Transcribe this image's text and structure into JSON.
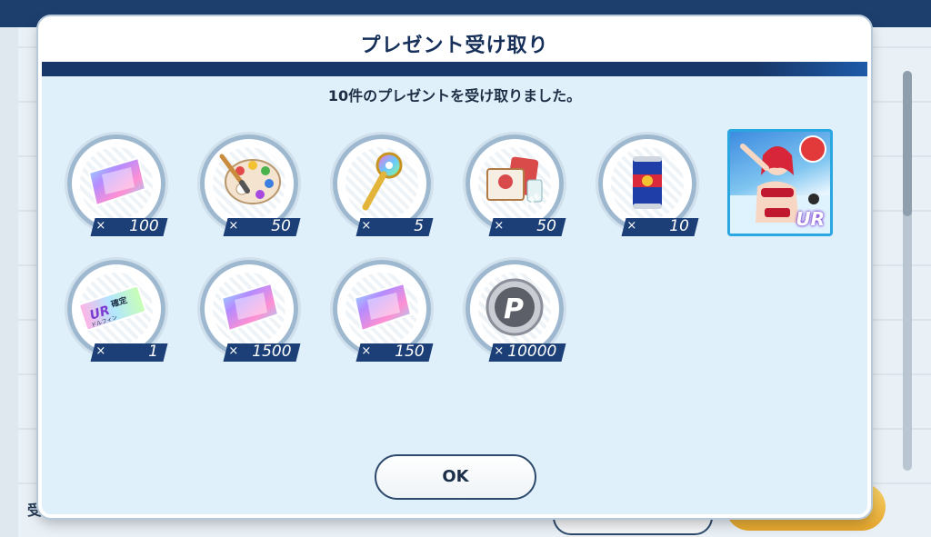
{
  "modal": {
    "title": "プレゼント受け取り",
    "message": "10件のプレゼントを受け取りました。",
    "ok_label": "OK"
  },
  "items": [
    {
      "icon": "rainbow-gem-icon",
      "count": "100"
    },
    {
      "icon": "paint-palette-icon",
      "count": "50"
    },
    {
      "icon": "rainbow-key-icon",
      "count": "5"
    },
    {
      "icon": "cafe-cards-icon",
      "count": "50"
    },
    {
      "icon": "drink-can-icon",
      "count": "10"
    },
    {
      "icon": "ur-character-card",
      "count": ""
    },
    {
      "icon": "ur-dolphin-ticket-icon",
      "count": "1"
    },
    {
      "icon": "rainbow-gem-icon",
      "count": "1500"
    },
    {
      "icon": "rainbow-gem-icon",
      "count": "150"
    },
    {
      "icon": "p-coin-icon",
      "count": "10000"
    }
  ],
  "count_prefix": "×",
  "card_rank": "UR",
  "ticket_text": {
    "rank": "UR",
    "confirm": "確定",
    "name": "ドルフィン"
  },
  "coin_text": "P",
  "cafe_text": "CAFE",
  "background": {
    "bottom_label": "受"
  },
  "colors": {
    "header_band": "#18386a",
    "count_tag": "#1c3f78",
    "modal_bg": "#dff0fb"
  }
}
